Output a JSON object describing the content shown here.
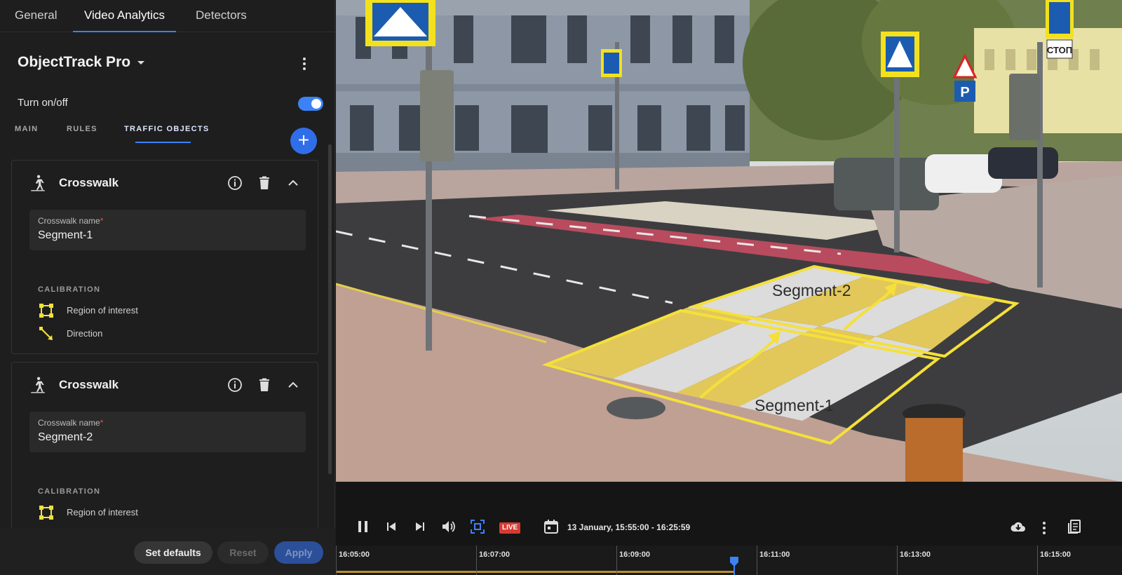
{
  "top_tabs": [
    {
      "label": "General",
      "active": false
    },
    {
      "label": "Video Analytics",
      "active": true
    },
    {
      "label": "Detectors",
      "active": false
    }
  ],
  "module": {
    "title": "ObjectTrack Pro",
    "toggle_label": "Turn on/off",
    "toggle_on": true
  },
  "sub_tabs": [
    {
      "label": "MAIN",
      "active": false
    },
    {
      "label": "RULES",
      "active": false
    },
    {
      "label": "TRAFFIC OBJECTS",
      "active": true
    }
  ],
  "cards": [
    {
      "title": "Crosswalk",
      "field_label": "Crosswalk name",
      "field_required_mark": "*",
      "field_value": "Segment-1",
      "calibration_title": "CALIBRATION",
      "calibration_items": [
        {
          "label": "Region of interest",
          "icon": "region-icon"
        },
        {
          "label": "Direction",
          "icon": "direction-icon"
        }
      ]
    },
    {
      "title": "Crosswalk",
      "field_label": "Crosswalk name",
      "field_required_mark": "*",
      "field_value": "Segment-2",
      "calibration_title": "CALIBRATION",
      "calibration_items": [
        {
          "label": "Region of interest",
          "icon": "region-icon"
        }
      ]
    }
  ],
  "footer": {
    "set_defaults": "Set defaults",
    "reset": "Reset",
    "apply": "Apply"
  },
  "video": {
    "overlay_labels": [
      "Segment-2",
      "Segment-1"
    ],
    "sign_text": "СТОП"
  },
  "player": {
    "live_label": "LIVE",
    "date_range": "13 January, 15:55:00 - 16:25:59"
  },
  "timeline": {
    "ticks": [
      "16:05:00",
      "16:07:00",
      "16:09:00",
      "16:11:00",
      "16:13:00",
      "16:15:00"
    ],
    "progress_fraction": 0.507
  },
  "colors": {
    "accent": "#3b82f6",
    "overlay": "#f5e03a",
    "live": "#d63b32",
    "progress": "#b8912e"
  }
}
